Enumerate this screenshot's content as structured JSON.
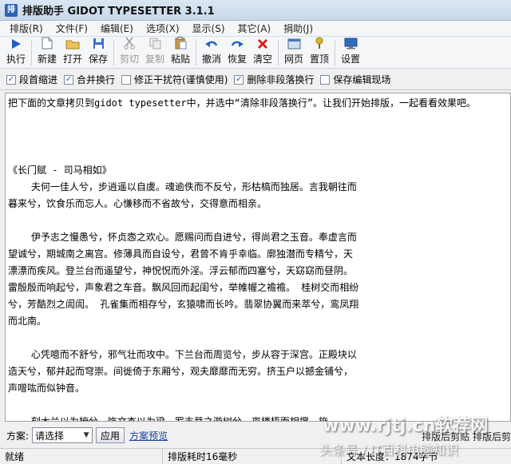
{
  "window": {
    "title": "排版助手 GIDOT TYPESETTER 3.1.1",
    "icon": "app-icon"
  },
  "menu": [
    "排版(R)",
    "文件(F)",
    "编辑(E)",
    "选项(X)",
    "显示(S)",
    "其它(A)",
    "捐助(J)"
  ],
  "toolbar": [
    {
      "label": "执行",
      "icon": "play-icon",
      "enabled": true
    },
    {
      "label": "新建",
      "icon": "new-file-icon",
      "enabled": true
    },
    {
      "label": "打开",
      "icon": "open-folder-icon",
      "enabled": true
    },
    {
      "label": "保存",
      "icon": "save-icon",
      "enabled": true
    },
    {
      "label": "剪切",
      "icon": "cut-icon",
      "enabled": false
    },
    {
      "label": "复制",
      "icon": "copy-icon",
      "enabled": false
    },
    {
      "label": "粘贴",
      "icon": "paste-icon",
      "enabled": true
    },
    {
      "label": "撤消",
      "icon": "undo-icon",
      "enabled": true
    },
    {
      "label": "恢复",
      "icon": "redo-icon",
      "enabled": true
    },
    {
      "label": "清空",
      "icon": "clear-icon",
      "enabled": true
    },
    {
      "label": "网页",
      "icon": "web-icon",
      "enabled": true
    },
    {
      "label": "置顶",
      "icon": "pin-top-icon",
      "enabled": true
    },
    {
      "label": "设置",
      "icon": "settings-icon",
      "enabled": true
    }
  ],
  "options": [
    {
      "label": "段首缩进",
      "checked": true
    },
    {
      "label": "合并换行",
      "checked": true
    },
    {
      "label": "修正干扰符(谨慎使用)",
      "checked": false
    },
    {
      "label": "删除非段落换行",
      "checked": true
    },
    {
      "label": "保存编辑现场",
      "checked": false
    }
  ],
  "editor": {
    "intro": "把下面的文章拷贝到gidot typesetter中，并选中“清除非段落换行”。让我们开始排版，一起看看效果吧。",
    "article_title": "《长门赋 - 司马相如》",
    "paragraphs": [
      "    夫何一佳人兮，步逍遥以自虞。魂逾佚而不反兮，形枯槁而独居。言我朝往而暮来兮，饮食乐而忘人。心慊移而不省故兮，交得意而相亲。",
      "    伊予志之慢愚兮，怀贞悫之欢心。愿赐问而自进兮，得尚君之玉音。奉虚言而望诚兮，期城南之离宫。修薄具而自设兮，君曾不肯乎幸临。廓独潜而专精兮，天漂漂而疾风。登兰台而遥望兮，神怳怳而外淫。浮云郁而四塞兮，天窈窈而昼阴。雷殷殷而响起兮，声象君之车音。飘风回而起闺兮，举帷幄之襜襜。 桂树交而相纷兮，芳酷烈之訚訚。 孔雀集而相存兮，玄猿啸而长吟。翡翠协翼而来萃兮，鸾凤翔而北南。",
      "    心凭噫而不舒兮，邪气壮而攻中。下兰台而周览兮，步从容于深宫。正殿块以造天兮，郁并起而穹崇。间徙倚于东厢兮，观夫靡靡而无穷。挤玉户以撼金铺兮，声噌吰而似钟音。",
      "    刻木兰以为榱兮，饰文杏以为梁。罗丰茸之游树兮，离楼梧而相撑。施"
    ]
  },
  "planbar": {
    "label": "方案:",
    "select_value": "请选择",
    "apply": "应用",
    "preview": "方案预览",
    "right_text": "排版后剪贴   排版后剪"
  },
  "status": {
    "ready": "就绪",
    "time": "排版耗时16毫秒",
    "length": "文本长度：1874字节"
  },
  "watermark": {
    "site": "www.rjtj.cn软荐网",
    "byline": "头条号 / IT百科电脑知识"
  }
}
